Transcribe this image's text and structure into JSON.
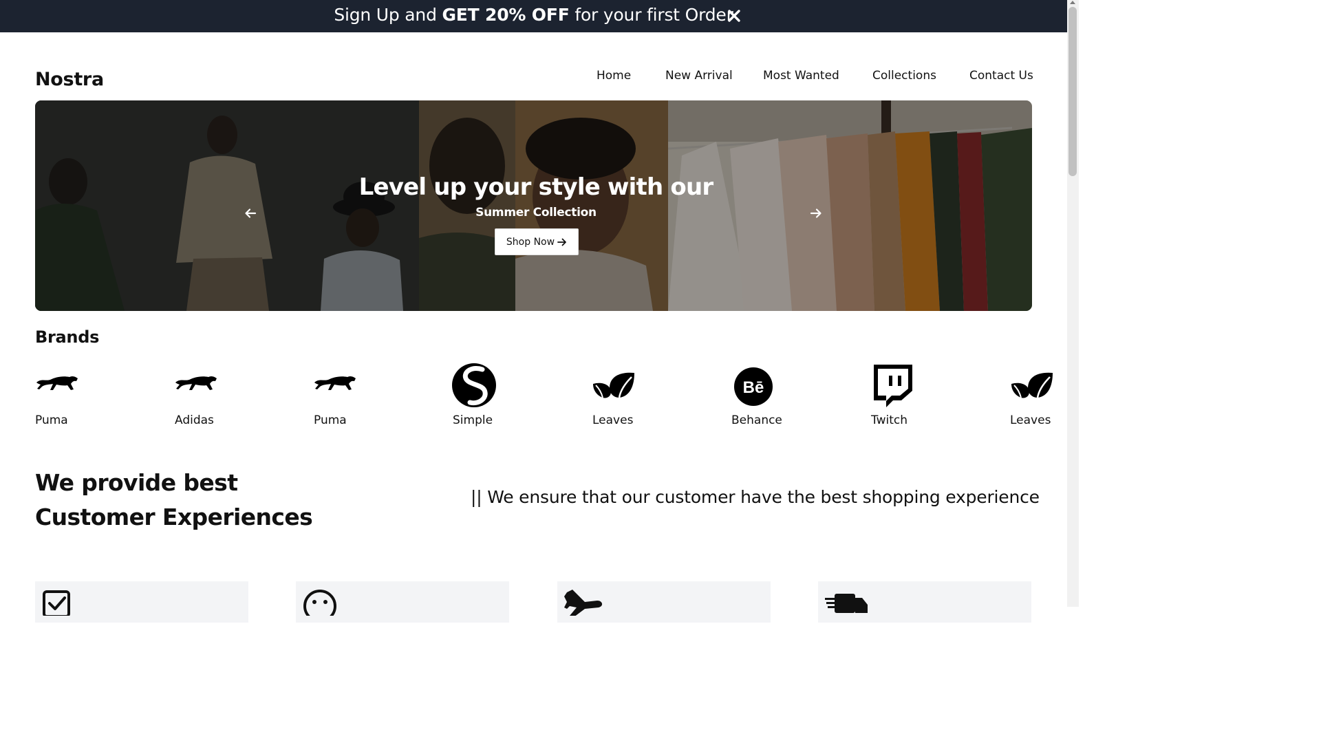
{
  "promo": {
    "prefix": "Sign Up and ",
    "highlight": "GET 20% OFF",
    "suffix": " for your first Order"
  },
  "header": {
    "logo": "Nostra",
    "nav": [
      "Home",
      "New Arrival",
      "Most Wanted",
      "Collections",
      "Contact Us"
    ]
  },
  "hero": {
    "title": "Level up your style with our",
    "subtitle": "Summer Collection",
    "cta": "Shop Now"
  },
  "brands": {
    "title": "Brands",
    "items": [
      {
        "label": "Puma",
        "icon": "puma-icon"
      },
      {
        "label": "Adidas",
        "icon": "puma-icon"
      },
      {
        "label": "Puma",
        "icon": "puma-icon"
      },
      {
        "label": "Simple",
        "icon": "simple-icon"
      },
      {
        "label": "Leaves",
        "icon": "leaves-icon"
      },
      {
        "label": "Behance",
        "icon": "behance-icon"
      },
      {
        "label": "Twitch",
        "icon": "twitch-icon"
      },
      {
        "label": "Leaves",
        "icon": "leaves-icon"
      }
    ]
  },
  "experience": {
    "title_line1": "We provide best",
    "title_line2": "Customer Experiences",
    "tagline": "|| We ensure that our customer have the best shopping experience"
  },
  "features": {
    "icons": [
      "checkbox-icon",
      "smiley-icon",
      "airplane-icon",
      "fast-truck-icon"
    ]
  },
  "colors": {
    "promo_bg": "#1c2330",
    "card_bg": "#f3f4f6"
  }
}
